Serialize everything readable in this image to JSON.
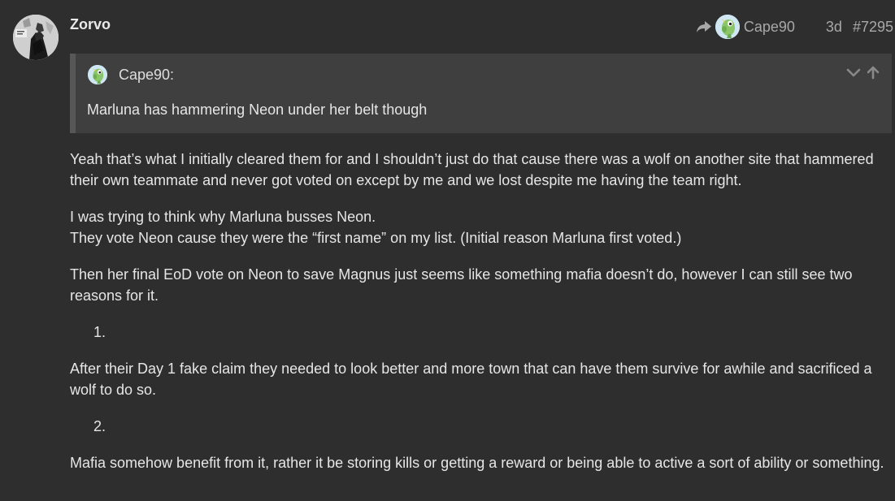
{
  "post": {
    "username": "Zorvo",
    "reply_to": "Cape90",
    "age": "3d",
    "post_number": "#7295"
  },
  "quote": {
    "author": "Cape90:",
    "text": "Marluna has hammering Neon under her belt though"
  },
  "body": {
    "p1": "Yeah that’s what I initially cleared them for and I shouldn’t just do that cause there was a wolf on another site that hammered their own teammate and never got voted on except by me and we lost despite me having the team right.",
    "p2_line1": "I was trying to think why Marluna busses Neon.",
    "p2_line2": "They vote Neon cause they were the “first name” on my list. (Initial reason Marluna first voted.)",
    "p3": "Then her final EoD vote on Neon to save Magnus just seems like something mafia doesn’t do, however I can still see two reasons for it.",
    "item1_marker": "1.",
    "p4": "After their Day 1 fake claim they needed to look better and more town that can have them survive for awhile and sacrificed a wolf to do so.",
    "item2_marker": "2.",
    "p5": "Mafia somehow benefit from it, rather it be storing kills or getting a reward or being able to active a sort of ability or something."
  },
  "colors": {
    "background": "#2e2e2e",
    "quote_background": "#3f3f3f",
    "quote_border": "#575757",
    "text": "#e6e6e6",
    "muted": "#a8a8a8"
  },
  "icons": {
    "reply": "share-arrow-icon",
    "expand": "chevron-down-icon",
    "jump": "arrow-up-icon"
  }
}
